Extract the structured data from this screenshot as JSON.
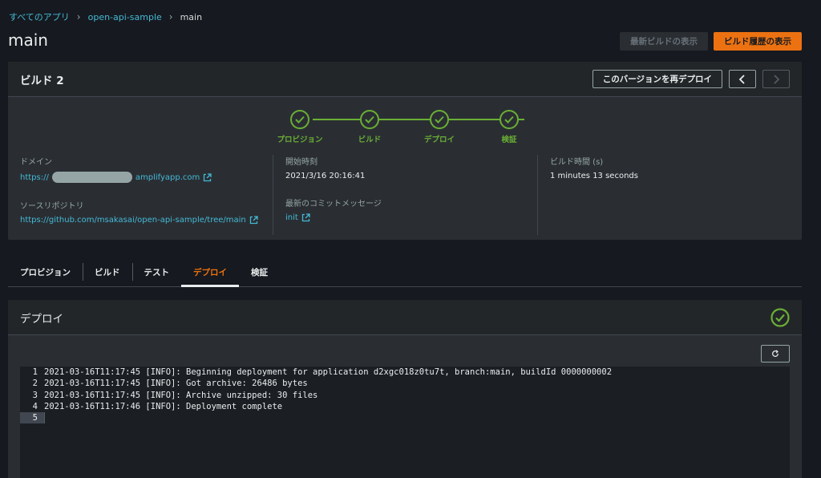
{
  "breadcrumb": {
    "all_apps": "すべてのアプリ",
    "app": "open-api-sample",
    "branch": "main"
  },
  "page": {
    "title": "main"
  },
  "actions": {
    "latest_build": "最新ビルドの表示",
    "build_history": "ビルド履歴の表示"
  },
  "build": {
    "title": "ビルド 2",
    "redeploy": "このバージョンを再デプロイ",
    "steps": [
      "プロビジョン",
      "ビルド",
      "デプロイ",
      "検証"
    ],
    "domain_label": "ドメイン",
    "domain_prefix": "https://",
    "domain_suffix": "amplifyapp.com",
    "repo_label": "ソースリポジトリ",
    "repo_value": "https://github.com/msakasai/open-api-sample/tree/main",
    "start_label": "開始時刻",
    "start_value": "2021/3/16 20:16:41",
    "commit_label": "最新のコミットメッセージ",
    "commit_value": "init",
    "duration_label": "ビルド時間 (s)",
    "duration_value": "1 minutes 13 seconds"
  },
  "tabs": [
    "プロビジョン",
    "ビルド",
    "テスト",
    "デプロイ",
    "検証"
  ],
  "deploy": {
    "title": "デプロイ",
    "log": [
      {
        "num": "1",
        "text": "2021-03-16T11:17:45 [INFO]: Beginning deployment for application d2xgc018z0tu7t, branch:main, buildId 0000000002"
      },
      {
        "num": "2",
        "text": "2021-03-16T11:17:45 [INFO]: Got archive: 26486 bytes"
      },
      {
        "num": "3",
        "text": "2021-03-16T11:17:45 [INFO]: Archive unzipped: 30 files"
      },
      {
        "num": "4",
        "text": "2021-03-16T11:17:46 [INFO]: Deployment complete"
      },
      {
        "num": "5",
        "text": ""
      }
    ]
  },
  "colors": {
    "accent": "#ec7211",
    "success": "#6aaf35",
    "link": "#44b9d6"
  }
}
